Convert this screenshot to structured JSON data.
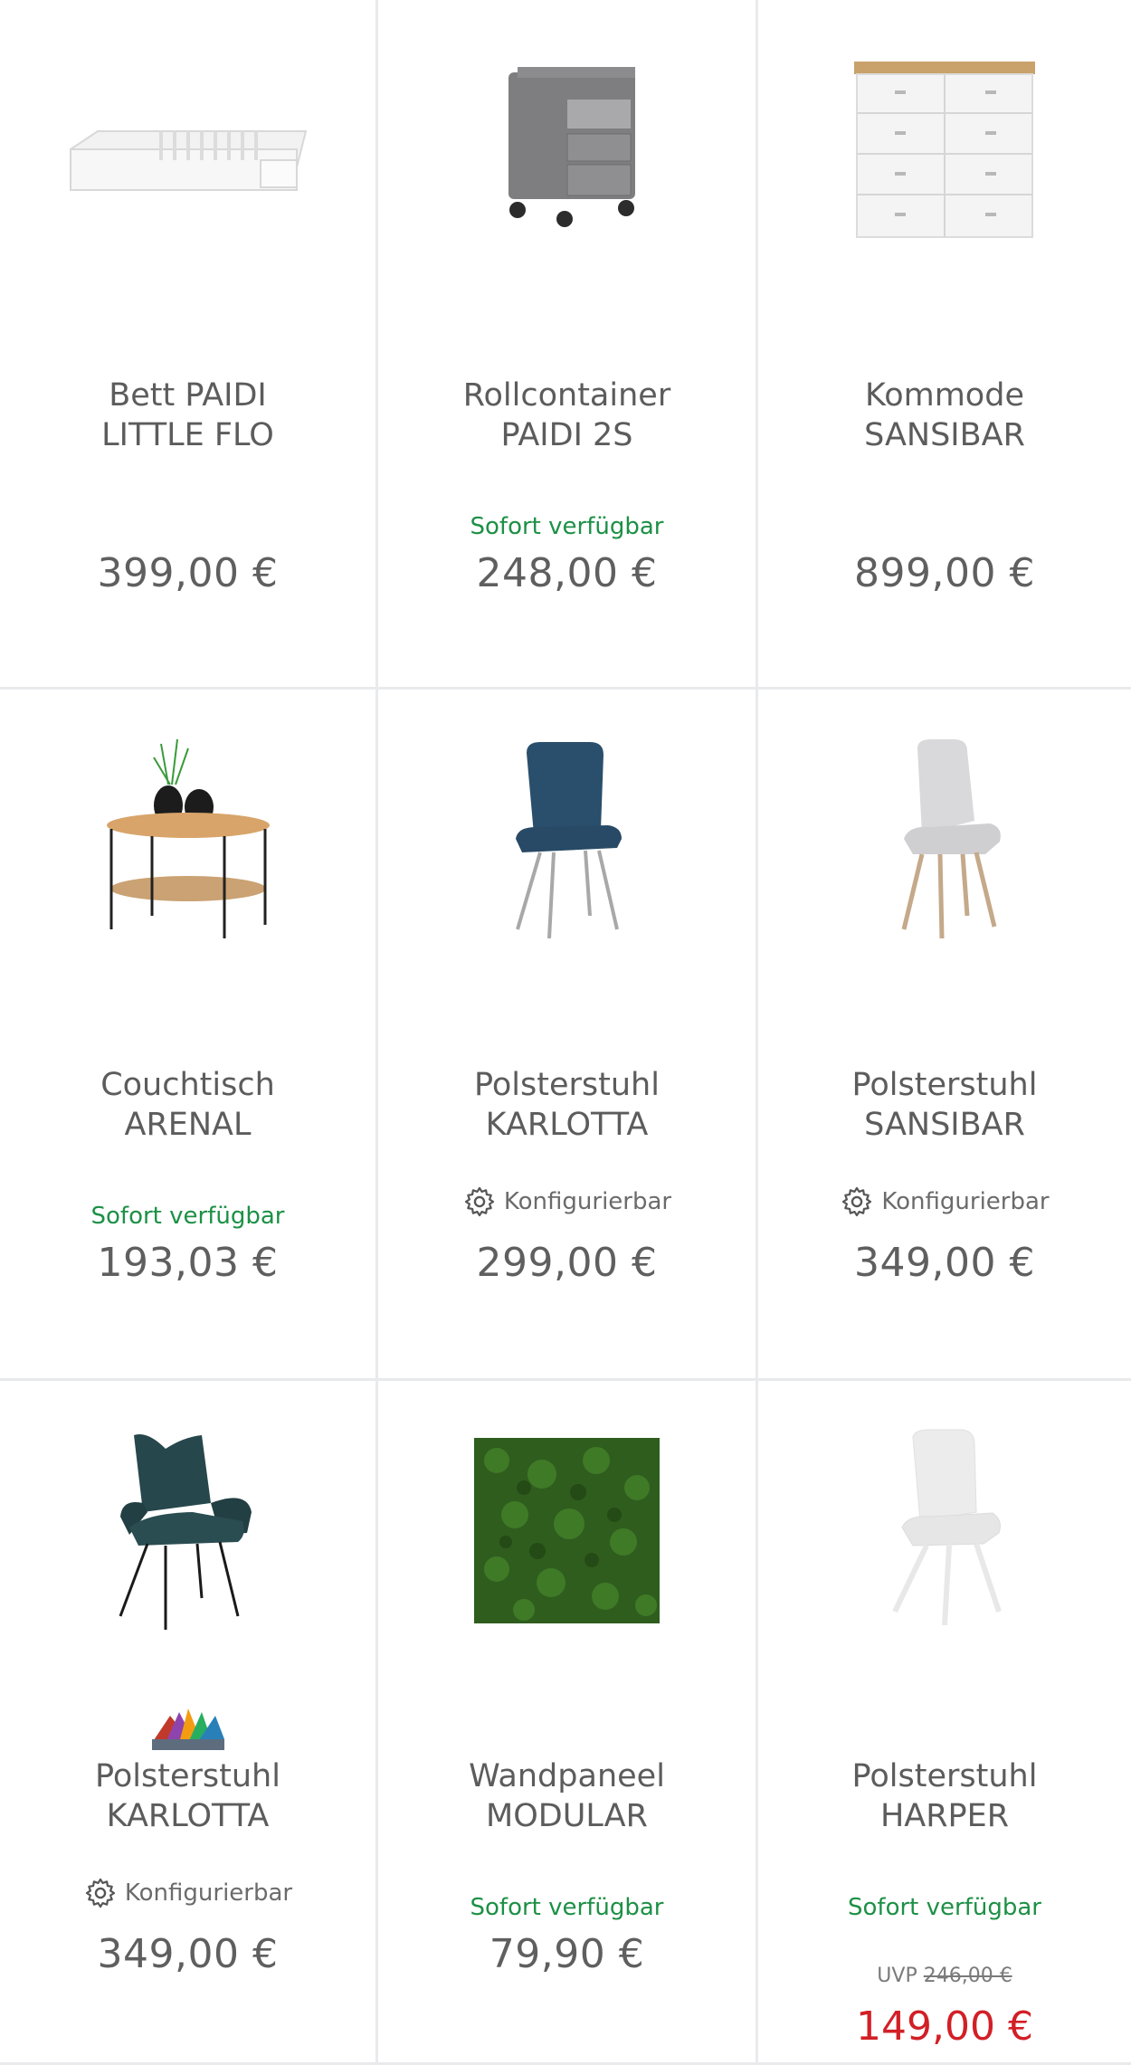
{
  "products": [
    {
      "name1": "Bett PAIDI",
      "name2": "LITTLE FLO",
      "price": "399,00 €"
    },
    {
      "name1": "Rollcontainer",
      "name2": "PAIDI 2S",
      "availability": "Sofort verfügbar",
      "price": "248,00 €"
    },
    {
      "name1": "Kommode",
      "name2": "SANSIBAR",
      "price": "899,00 €"
    },
    {
      "name1": "Couchtisch",
      "name2": "ARENAL",
      "availability": "Sofort verfügbar",
      "price": "193,03 €"
    },
    {
      "name1": "Polsterstuhl",
      "name2": "KARLOTTA",
      "config": "Konfigurierbar",
      "price": "299,00 €"
    },
    {
      "name1": "Polsterstuhl",
      "name2": "SANSIBAR",
      "config": "Konfigurierbar",
      "price": "349,00 €"
    },
    {
      "name1": "Polsterstuhl",
      "name2": "KARLOTTA",
      "config": "Konfigurierbar",
      "price": "349,00 €"
    },
    {
      "name1": "Wandpaneel",
      "name2": "MODULAR",
      "availability": "Sofort verfügbar",
      "price": "79,90 €"
    },
    {
      "name1": "Polsterstuhl",
      "name2": "HARPER",
      "availability": "Sofort verfügbar",
      "uvp_label": "UVP",
      "uvp_price": "246,00 €",
      "price": "149,00 €"
    }
  ],
  "colors": {
    "availability": "#1d9046",
    "sale": "#d21f26",
    "text": "#5c5c5c",
    "divider": "#e9eaec"
  }
}
